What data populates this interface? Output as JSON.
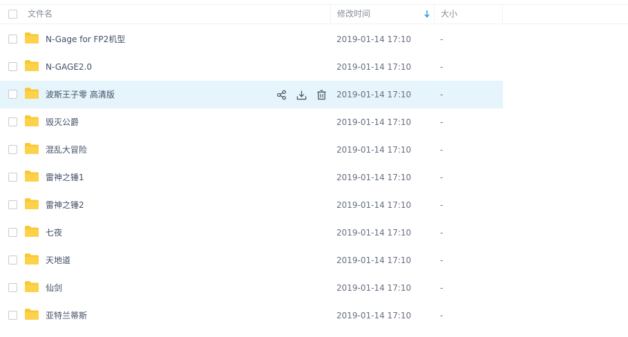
{
  "header": {
    "select_all": false,
    "name_label": "文件名",
    "time_label": "修改时间",
    "size_label": "大小",
    "sort_icon": "sort-down-icon",
    "sort_color": "#1e9ae0"
  },
  "row_actions": {
    "icons": [
      "share-icon",
      "download-icon",
      "delete-icon"
    ]
  },
  "colors": {
    "folder": "#f9c932",
    "hover": "#e6f4fb"
  },
  "rows": [
    {
      "name": "N-Gage for FP2机型",
      "time": "2019-01-14 17:10",
      "size": "-",
      "hover": false
    },
    {
      "name": "N-GAGE2.0",
      "time": "2019-01-14 17:10",
      "size": "-",
      "hover": false
    },
    {
      "name": "波斯王子零 高清版",
      "time": "2019-01-14 17:10",
      "size": "-",
      "hover": true
    },
    {
      "name": "毁灭公爵",
      "time": "2019-01-14 17:10",
      "size": "-",
      "hover": false
    },
    {
      "name": "混乱大冒险",
      "time": "2019-01-14 17:10",
      "size": "-",
      "hover": false
    },
    {
      "name": "雷神之锤1",
      "time": "2019-01-14 17:10",
      "size": "-",
      "hover": false
    },
    {
      "name": "雷神之锤2",
      "time": "2019-01-14 17:10",
      "size": "-",
      "hover": false
    },
    {
      "name": "七夜",
      "time": "2019-01-14 17:10",
      "size": "-",
      "hover": false
    },
    {
      "name": "天地道",
      "time": "2019-01-14 17:10",
      "size": "-",
      "hover": false
    },
    {
      "name": "仙剑",
      "time": "2019-01-14 17:10",
      "size": "-",
      "hover": false
    },
    {
      "name": "亚特兰蒂斯",
      "time": "2019-01-14 17:10",
      "size": "-",
      "hover": false
    }
  ]
}
